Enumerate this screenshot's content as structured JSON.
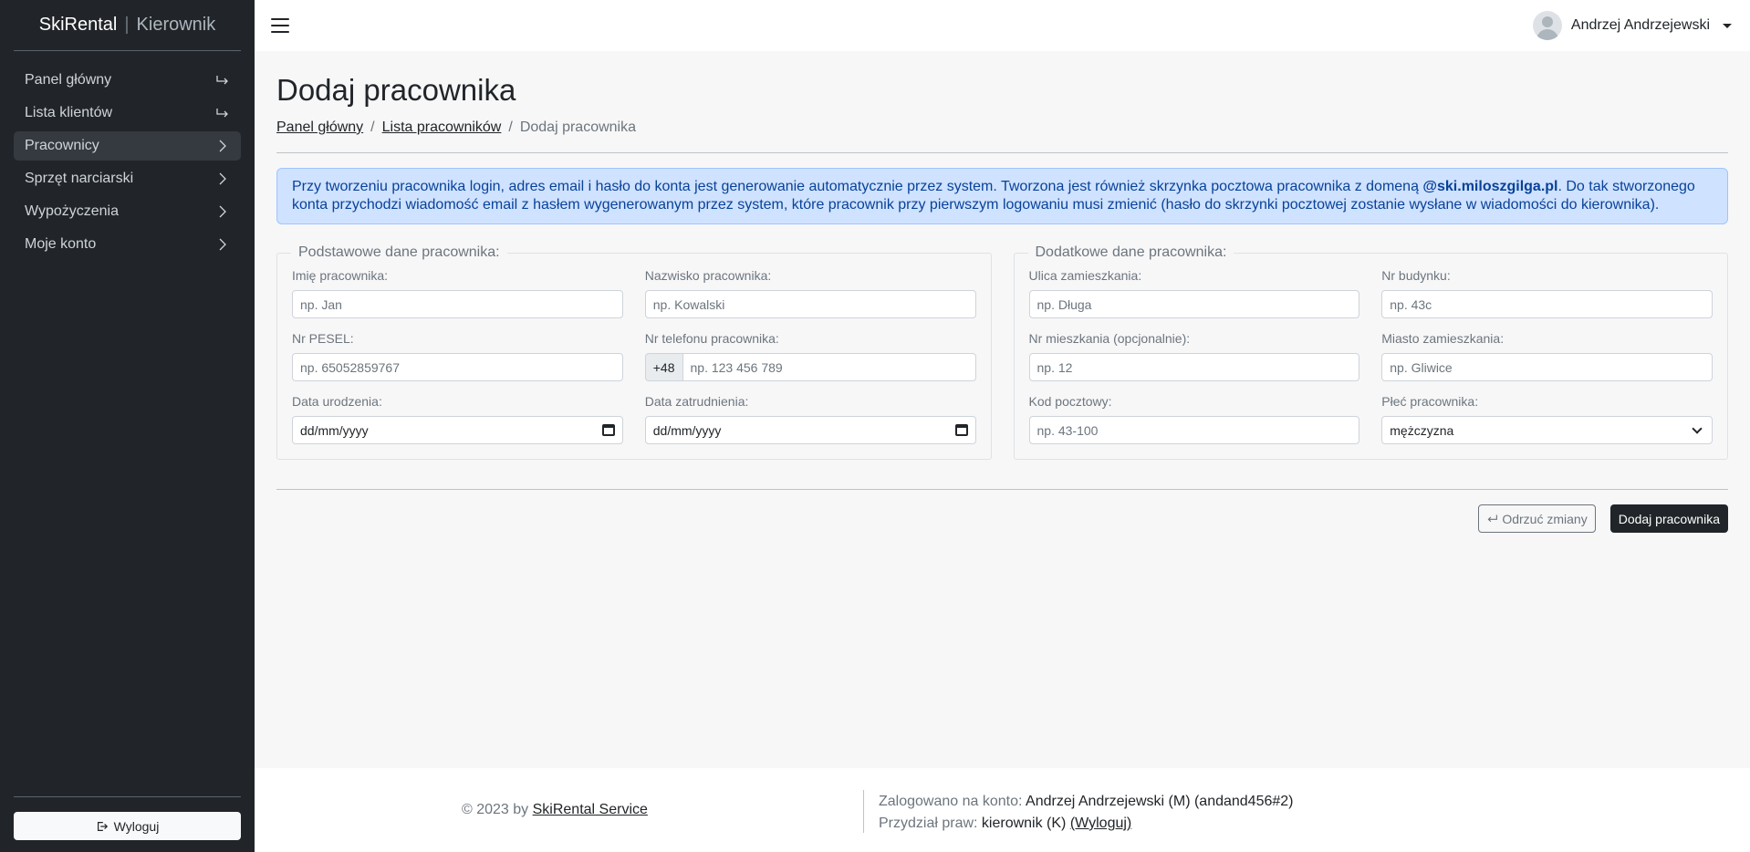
{
  "brand": {
    "app": "SkiRental",
    "role": "Kierownik"
  },
  "sidebar": {
    "items": [
      {
        "label": "Panel główny",
        "icon": "arrow-return-right-icon"
      },
      {
        "label": "Lista klientów",
        "icon": "arrow-return-right-icon"
      },
      {
        "label": "Pracownicy",
        "icon": "chevron-right-icon"
      },
      {
        "label": "Sprzęt narciarski",
        "icon": "chevron-right-icon"
      },
      {
        "label": "Wypożyczenia",
        "icon": "chevron-right-icon"
      },
      {
        "label": "Moje konto",
        "icon": "chevron-right-icon"
      }
    ],
    "logout_label": "Wyloguj"
  },
  "topbar": {
    "user_name": "Andrzej Andrzejewski"
  },
  "page": {
    "title": "Dodaj pracownika",
    "breadcrumb": [
      "Panel główny",
      "Lista pracowników",
      "Dodaj pracownika"
    ],
    "alert": {
      "text_before": "Przy tworzeniu pracownika login, adres email i hasło do konta jest generowanie automatycznie przez system. Tworzona jest również skrzynka pocztowa pracownika z domeną ",
      "domain": "@ski.miloszgilga.pl",
      "text_after": ". Do tak stworzonego konta przychodzi wiadomość email z hasłem wygenerowanym przez system, które pracownik przy pierwszym logowaniu musi zmienić (hasło do skrzynki pocztowej zostanie wysłane w wiadomości do kierownika)."
    }
  },
  "basic": {
    "legend": "Podstawowe dane pracownika:",
    "first_name": {
      "label": "Imię pracownika:",
      "placeholder": "np. Jan"
    },
    "last_name": {
      "label": "Nazwisko pracownika:",
      "placeholder": "np. Kowalski"
    },
    "pesel": {
      "label": "Nr PESEL:",
      "placeholder": "np. 65052859767"
    },
    "phone": {
      "label": "Nr telefonu pracownika:",
      "prefix": "+48",
      "placeholder": "np. 123 456 789"
    },
    "birth_date": {
      "label": "Data urodzenia:",
      "value": "dd/mm/yyyy"
    },
    "hire_date": {
      "label": "Data zatrudnienia:",
      "value": "dd/mm/yyyy"
    }
  },
  "extra": {
    "legend": "Dodatkowe dane pracownika:",
    "street": {
      "label": "Ulica zamieszkania:",
      "placeholder": "np. Długa"
    },
    "building": {
      "label": "Nr budynku:",
      "placeholder": "np. 43c"
    },
    "apartment": {
      "label": "Nr mieszkania (opcjonalnie):",
      "placeholder": "np. 12"
    },
    "city": {
      "label": "Miasto zamieszkania:",
      "placeholder": "np. Gliwice"
    },
    "postal": {
      "label": "Kod pocztowy:",
      "placeholder": "np. 43-100"
    },
    "gender": {
      "label": "Płeć pracownika:",
      "value": "mężczyzna"
    }
  },
  "actions": {
    "discard": "Odrzuć zmiany",
    "submit": "Dodaj pracownika"
  },
  "footer": {
    "copy_prefix": "© 2023 by ",
    "copy_link": "SkiRental Service",
    "logged_label": "Zalogowano na konto: ",
    "logged_value": "Andrzej Andrzejewski (M) (andand456#2)",
    "rights_label": "Przydział praw: ",
    "rights_value": "kierownik (K) ",
    "logout_link": "(Wyloguj)"
  }
}
